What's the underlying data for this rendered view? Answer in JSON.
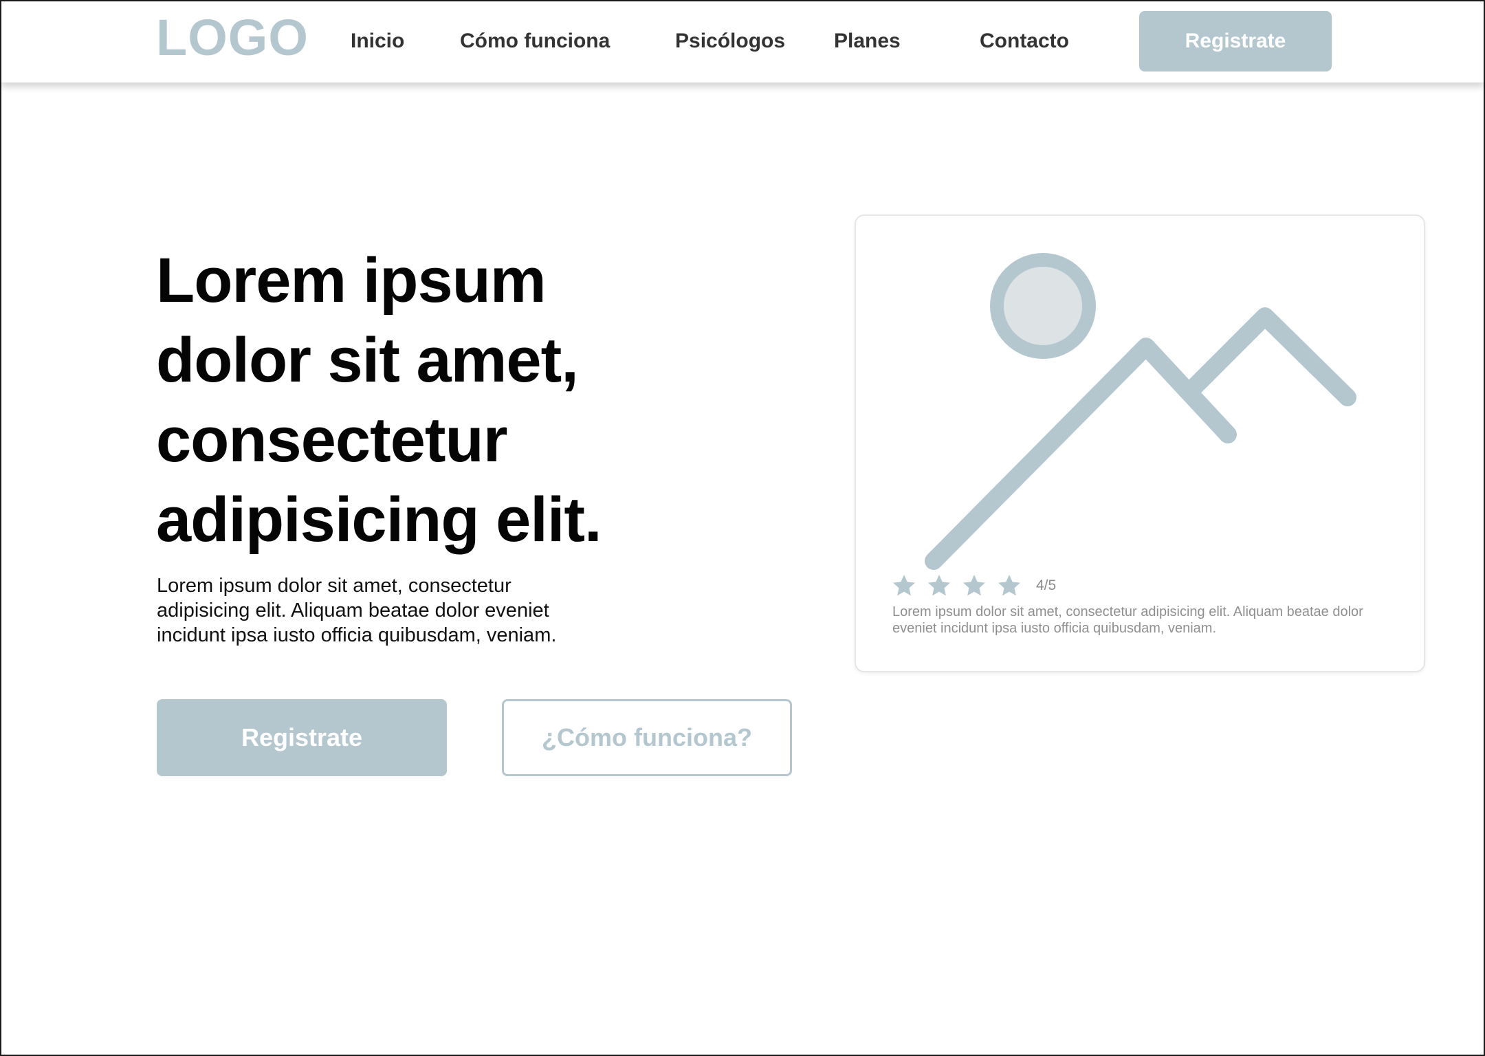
{
  "header": {
    "logo": "LOGO",
    "nav": [
      "Inicio",
      "Cómo funciona",
      "Psicólogos",
      "Planes",
      "Contacto"
    ],
    "cta_label": "Registrate"
  },
  "hero": {
    "title": "Lorem ipsum dolor sit amet, consectetur adipisicing elit.",
    "subtitle": "Lorem ipsum dolor sit amet, consectetur adipisicing elit. Aliquam beatae dolor eveniet incidunt ipsa iusto officia quibusdam, veniam.",
    "primary_button": "Registrate",
    "secondary_button": "¿Cómo funciona?"
  },
  "card": {
    "image_icon": "image-placeholder-icon",
    "rating": {
      "value": 4,
      "max": 5,
      "label": "4/5"
    },
    "text": "Lorem ipsum dolor sit amet, consectetur adipisicing elit. Aliquam beatae dolor eveniet incidunt ipsa iusto officia quibusdam, veniam."
  },
  "colors": {
    "accent": "#b4c7cf",
    "heading": "#050505",
    "nav_text": "#333333",
    "muted_text": "#8f8f8f",
    "sun_fill": "#dde2e5"
  }
}
